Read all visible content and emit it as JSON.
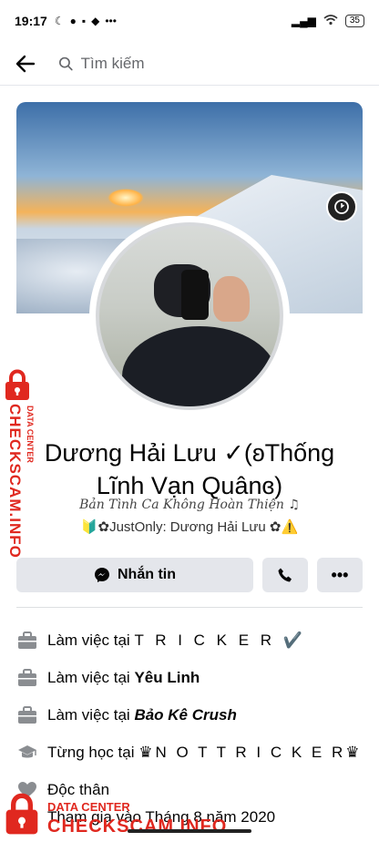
{
  "status_bar": {
    "time": "19:17",
    "battery": "35"
  },
  "header": {
    "search_placeholder": "Tìm kiếm"
  },
  "profile": {
    "name": "Dương Hải Lưu ✓(ʚThống Lĩnh Vạn Quânɞ)",
    "bio_line1": "Bản Tình Ca Không Hoàn Thiện ♫",
    "bio_line2": "🔰✿JustOnly: Dương Hải Lưu ✿⚠️"
  },
  "actions": {
    "message_label": "Nhắn tin"
  },
  "details": [
    {
      "prefix": "Làm việc tại ",
      "value": "T R I C K E R ✔️",
      "icon": "briefcase-icon",
      "style": "spaced"
    },
    {
      "prefix": "Làm việc tại ",
      "value": "Yêu Linh",
      "icon": "briefcase-icon",
      "style": "bold"
    },
    {
      "prefix": "Làm việc tại ",
      "value": "Bảo Kê Crush",
      "icon": "briefcase-icon",
      "style": "italic-bold"
    },
    {
      "prefix": "Từng học tại ",
      "value": "♛N O T  T R I C K E R♛",
      "icon": "graduation-cap-icon",
      "style": "spaced"
    },
    {
      "prefix": "Độc thân",
      "value": "",
      "icon": "heart-icon",
      "style": "plain"
    }
  ],
  "partial_row": "Tham gia vào Tháng 8 năm 2020",
  "watermark": {
    "brand": "CHECKSCAM.INFO",
    "sub": "DATA CENTER"
  },
  "colors": {
    "watermark": "#e0281f",
    "button_bg": "#e4e6eb"
  }
}
